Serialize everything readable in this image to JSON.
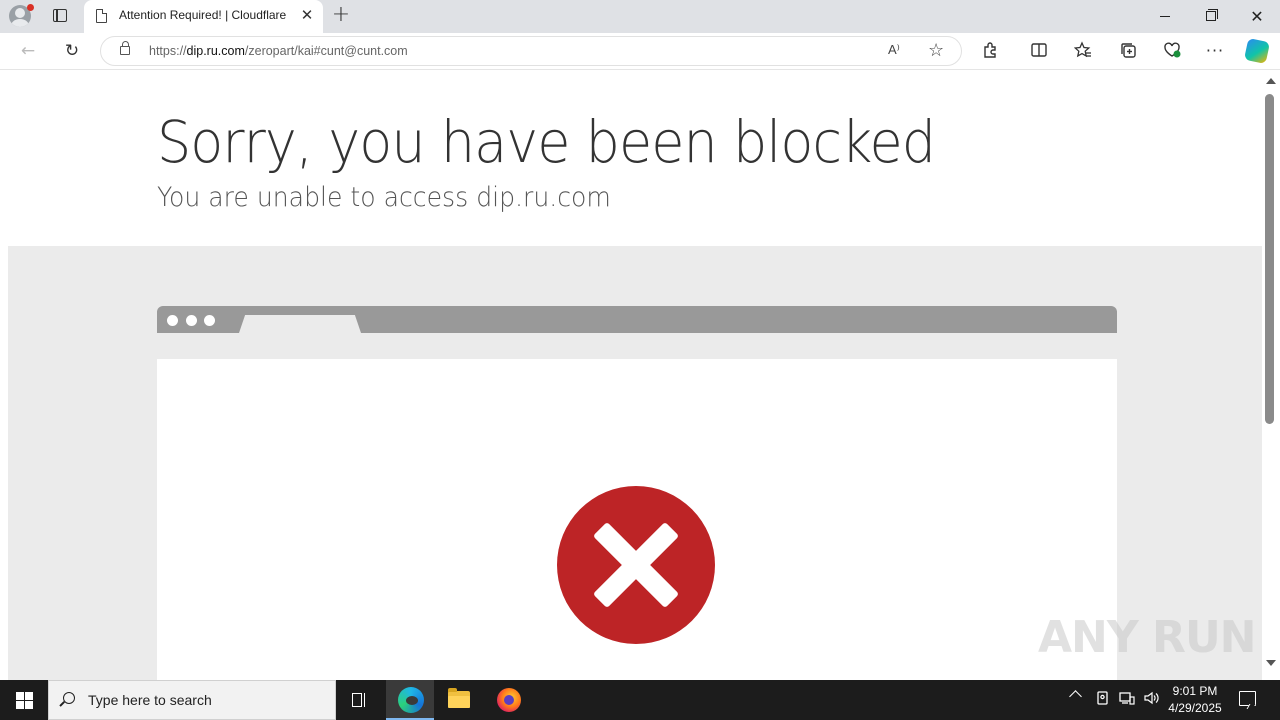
{
  "browser": {
    "tab_title": "Attention Required! | Cloudflare",
    "tab_close": "✕",
    "new_tab": "+",
    "url_scheme": "https://",
    "url_host": "dip.ru.com",
    "url_path": "/zeropart/kai#cunt@cunt.com",
    "read_aloud": "A⁾",
    "window_close": "✕"
  },
  "page": {
    "headline": "Sorry, you have been blocked",
    "subhead": "You are unable to access dip.ru.com",
    "block_icon_color": "#bd2426"
  },
  "watermark": {
    "text": "ANY RUN"
  },
  "taskbar": {
    "search_placeholder": "Type here to search",
    "time": "9:01 PM",
    "date": "4/29/2025"
  },
  "icons": {
    "back": "arrow-left-icon",
    "reload": "reload-icon",
    "lock": "lock-icon",
    "favorites": "star-icon",
    "extensions": "puzzle-icon",
    "more": "more-icon"
  }
}
